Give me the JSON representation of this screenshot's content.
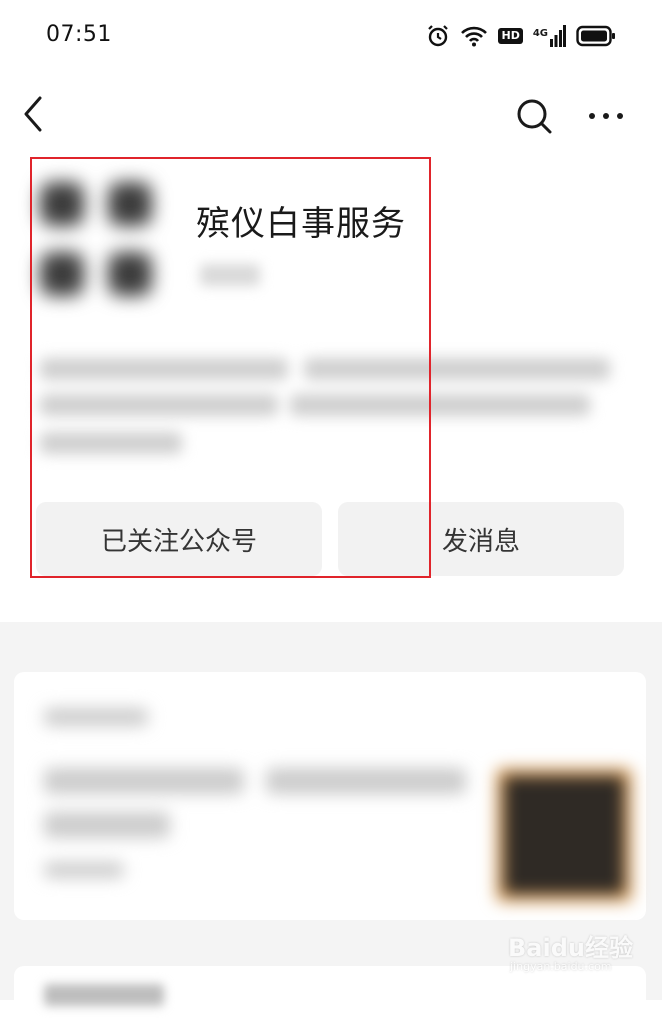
{
  "status_bar": {
    "time": "07:51",
    "icons": [
      "alarm-icon",
      "wifi-icon",
      "hd-icon",
      "signal-4g-icon",
      "battery-icon"
    ],
    "hd_label": "HD",
    "network_label": "4G"
  },
  "nav": {
    "icons": [
      "back-arrow-icon",
      "search-icon",
      "more-icon"
    ]
  },
  "profile": {
    "name": "殡仪白事服务"
  },
  "actions": {
    "followed_label": "已关注公众号",
    "message_label": "发消息"
  },
  "colors": {
    "highlight": "#e0242b",
    "button_bg": "#f2f2f2",
    "page_gray": "#f4f4f4"
  },
  "watermark": {
    "logo": "Baidu经验",
    "url": "jingyan.baidu.com"
  }
}
